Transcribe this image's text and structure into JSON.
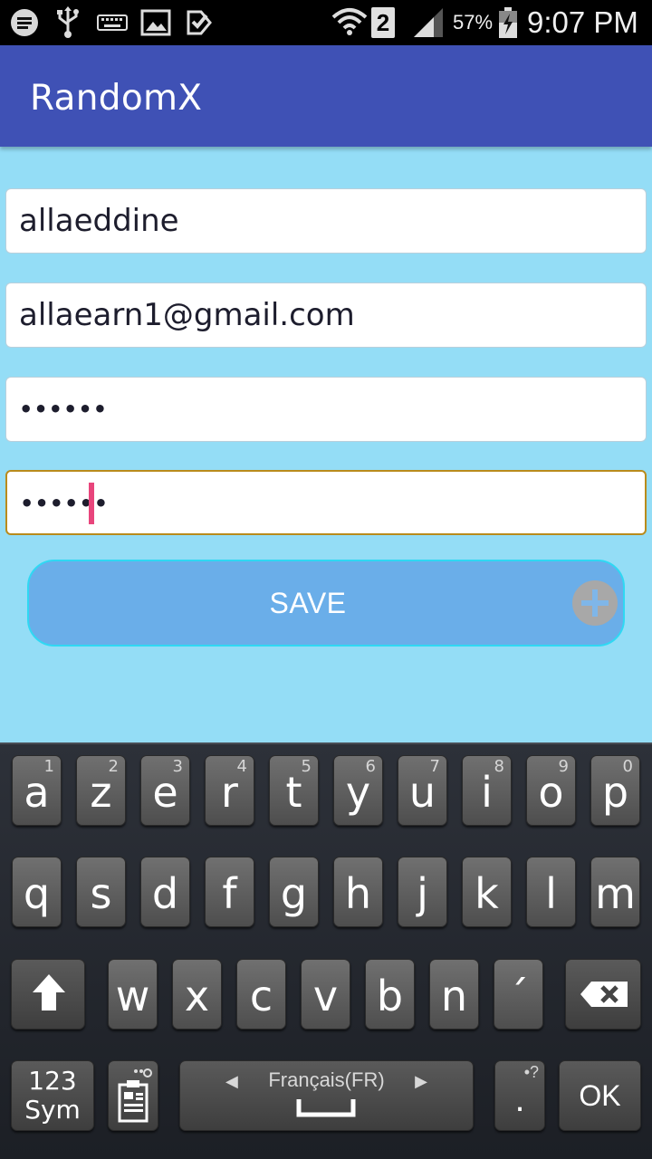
{
  "status_bar": {
    "icons": [
      "chat-notification-icon",
      "usb-icon",
      "keyboard-icon",
      "image-icon",
      "task-check-icon",
      "wifi-icon",
      "sim-2-icon",
      "signal-icon",
      "battery-icon"
    ],
    "sim_label": "2",
    "battery_percent": "57%",
    "time": "9:07 PM"
  },
  "app_bar": {
    "title": "RandomX",
    "color": "#3f51b5"
  },
  "form": {
    "username": "allaeddine",
    "email": "allaearn1@gmail.com",
    "password": "••••••",
    "confirm_password": "••••••",
    "save_label": "SAVE",
    "background": "#94ddf6",
    "button_color": "#6aaee9"
  },
  "keyboard": {
    "row1": [
      {
        "k": "a",
        "n": "1"
      },
      {
        "k": "z",
        "n": "2"
      },
      {
        "k": "e",
        "n": "3"
      },
      {
        "k": "r",
        "n": "4"
      },
      {
        "k": "t",
        "n": "5"
      },
      {
        "k": "y",
        "n": "6"
      },
      {
        "k": "u",
        "n": "7"
      },
      {
        "k": "i",
        "n": "8"
      },
      {
        "k": "o",
        "n": "9"
      },
      {
        "k": "p",
        "n": "0"
      }
    ],
    "row2": [
      "q",
      "s",
      "d",
      "f",
      "g",
      "h",
      "j",
      "k",
      "l",
      "m"
    ],
    "row3": [
      "w",
      "x",
      "c",
      "v",
      "b",
      "n",
      "´"
    ],
    "sym_line1": "123",
    "sym_line2": "Sym",
    "language": "Français(FR)",
    "punct_hint": "•?",
    "punct": ".",
    "ok": "OK"
  }
}
